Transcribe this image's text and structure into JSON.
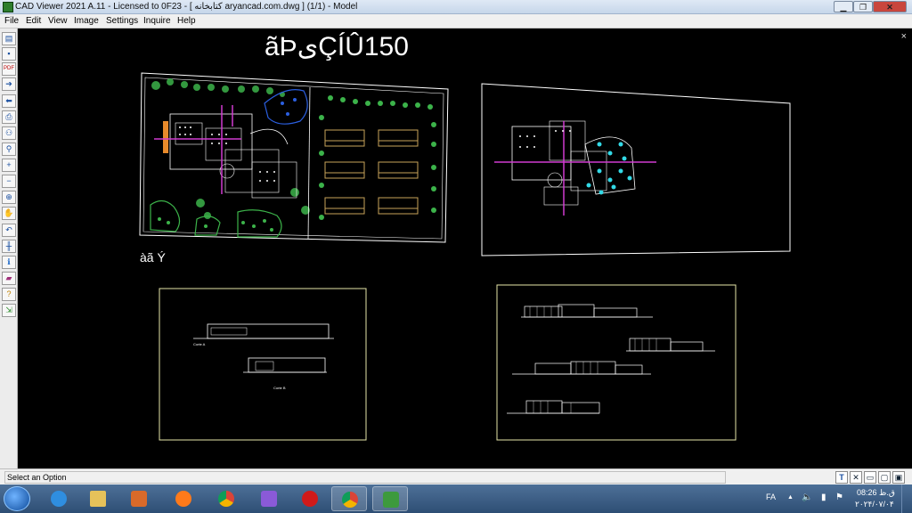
{
  "window": {
    "title": "CAD Viewer 2021 A.11 - Licensed to 0F23 - [ كتابخانه aryancad.com.dwg ] (1/1)  -  Model",
    "buttons": {
      "minimize": "▁",
      "maximize": "❐",
      "close": "✕"
    }
  },
  "menu": [
    "File",
    "Edit",
    "View",
    "Image",
    "Settings",
    "Inquire",
    "Help"
  ],
  "toolbar": {
    "icons": [
      "open-icon",
      "save-icon",
      "pdf-icon",
      "forward-icon",
      "back-icon",
      "print-icon",
      "binoculars-icon",
      "zoom-icon",
      "zoom-in-icon",
      "zoom-out-icon",
      "zoom-extents-icon",
      "pan-icon",
      "undo-icon",
      "layers-icon",
      "info-icon",
      "book-icon",
      "help-icon",
      "export-icon"
    ],
    "pdf_label": "PDF"
  },
  "drawing": {
    "garbled_title": "ãÞیÇÍÛ150",
    "garbled_label": "àã   Ý",
    "close_view": "×",
    "section_a_label": "Corte A",
    "section_b_label": "Corte B",
    "colors": {
      "frame": "#e6e6a8",
      "lines": "#ffffff",
      "magenta": "#d13bd1",
      "green": "#3cb34a",
      "cyan": "#33d9e6",
      "blue": "#2b5fe0",
      "tan": "#c9a35a",
      "orange": "#e88a2b"
    }
  },
  "status": {
    "text": "Select an Option",
    "buttons": [
      "T",
      "✕",
      "▭",
      "▢",
      "▣"
    ]
  },
  "taskbar": {
    "apps": [
      "ie-icon",
      "explorer-icon",
      "media-player-icon",
      "firefox-icon",
      "chrome-icon",
      "vs-icon",
      "opera-icon",
      "chrome-profile-icon",
      "cad-viewer-icon"
    ],
    "tray": {
      "lang": "FA",
      "arrow": "▲",
      "volume": "🔈",
      "network": "▮",
      "flag": "⚑"
    },
    "clock_time": "ق.ظ 08:26",
    "clock_date": "۲۰۲۴/۰۷/۰۴"
  }
}
